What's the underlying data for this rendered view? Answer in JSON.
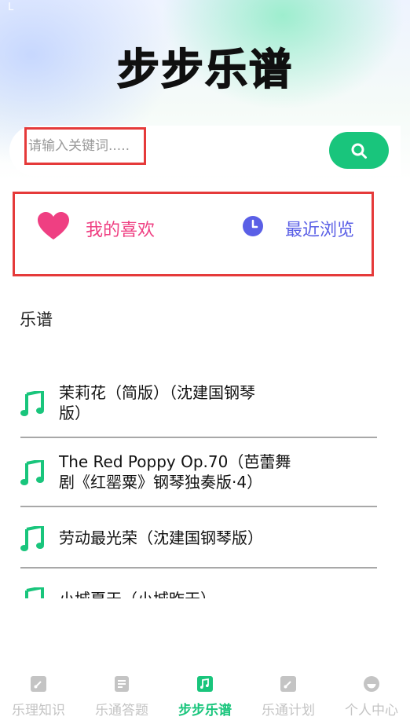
{
  "status_bar": {
    "mark": "L"
  },
  "header": {
    "title": "步步乐谱"
  },
  "search": {
    "placeholder": "请输入关键词....."
  },
  "quick_links": {
    "favorites_label": "我的喜欢",
    "recent_label": "最近浏览"
  },
  "section": {
    "title": "乐谱"
  },
  "scores": [
    {
      "line1": "茉莉花（简版）（沈建国钢琴",
      "line2": "版）"
    },
    {
      "line1": "The Red Poppy Op.70（芭蕾舞",
      "line2": "剧《红罂粟》钢琴独奏版·4）"
    },
    {
      "line1": "劳动最光荣（沈建国钢琴版）",
      "line2": ""
    },
    {
      "line1": "小城夏天（小城昨天）",
      "line2": ""
    }
  ],
  "tabbar": {
    "items": [
      {
        "label": "乐理知识",
        "icon": "music-book-icon"
      },
      {
        "label": "乐通答题",
        "icon": "document-icon"
      },
      {
        "label": "步步乐谱",
        "icon": "music-note-icon"
      },
      {
        "label": "乐通计划",
        "icon": "plan-icon"
      },
      {
        "label": "个人中心",
        "icon": "person-icon"
      }
    ],
    "active_index": 2
  },
  "colors": {
    "accent_green": "#19c57c",
    "favorite_pink": "#ef3f82",
    "recent_blue": "#5a5fe6",
    "highlight_red": "#e53a3a",
    "inactive_gray": "#c4c4c4"
  }
}
